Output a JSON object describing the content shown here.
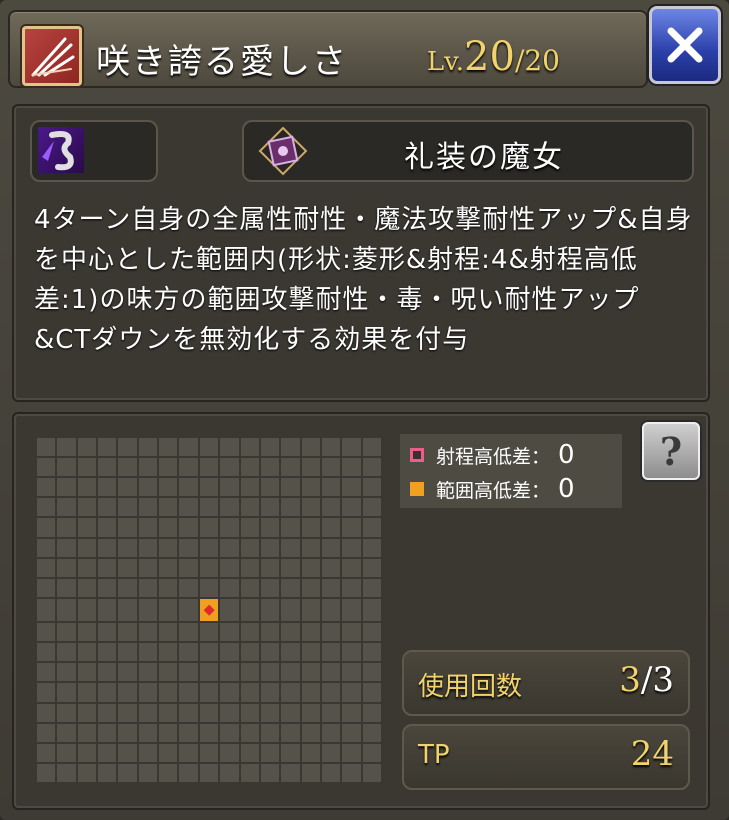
{
  "header": {
    "skill_name": "咲き誇る愛しさ",
    "level_label": "Lv.",
    "level_current": "20",
    "level_max": "/20"
  },
  "info": {
    "character_name": "礼装の魔女",
    "description": "4ターン自身の全属性耐性・魔法攻撃耐性アップ&自身を中心とした範囲内(形状:菱形&射程:4&射程高低差:1)の味方の範囲攻撃耐性・毒・呪い耐性アップ&CTダウンを無効化する効果を付与"
  },
  "range": {
    "grid_size": 17,
    "legend": [
      {
        "label": "射程高低差：",
        "value": "0",
        "color": "#e8608a"
      },
      {
        "label": "範囲高低差：",
        "value": "0",
        "color": "#f0a020"
      }
    ],
    "help_label": "?"
  },
  "stats": {
    "uses_label": "使用回数",
    "uses_current": "3",
    "uses_max": "/3",
    "tp_label": "TP",
    "tp_value": "24"
  },
  "colors": {
    "accent_gold": "#f2d36b",
    "close_blue": "#2a3fa8"
  },
  "icons": {
    "skill_type": "slash-icon",
    "attribute": "dark-attribute-icon",
    "character": "spellbook-icon",
    "close": "close-icon"
  }
}
